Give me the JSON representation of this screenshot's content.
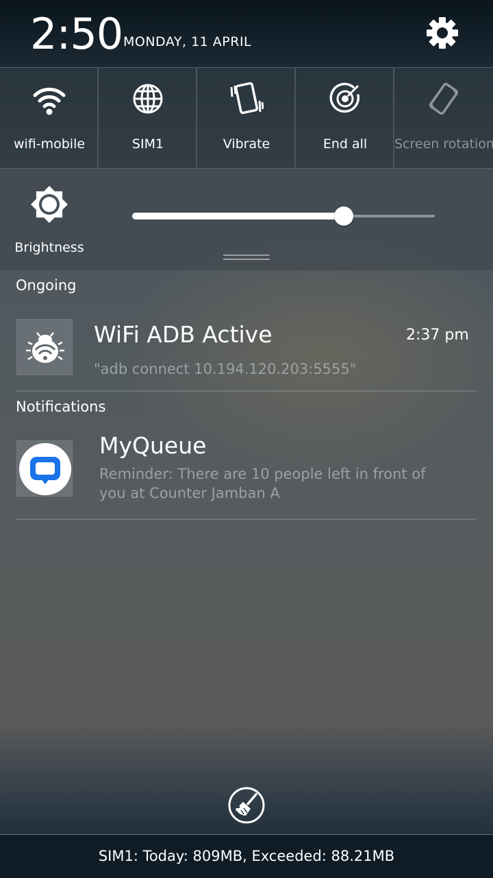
{
  "header": {
    "time": "2:50",
    "date": "MONDAY, 11 APRIL",
    "settings_icon": "gear-icon"
  },
  "quick_settings": [
    {
      "label": "wifi-mobile",
      "icon": "wifi-icon",
      "enabled": true
    },
    {
      "label": "SIM1",
      "icon": "globe-icon",
      "enabled": true
    },
    {
      "label": "Vibrate",
      "icon": "vibrate-icon",
      "enabled": true
    },
    {
      "label": "End all",
      "icon": "end-all-icon",
      "enabled": true
    },
    {
      "label": "Screen rotation",
      "icon": "screen-rotation-icon",
      "enabled": false
    }
  ],
  "brightness": {
    "label": "Brightness",
    "icon": "brightness-icon",
    "level": 0.7
  },
  "ongoing": {
    "section_title": "Ongoing",
    "items": [
      {
        "title": "WiFi ADB Active",
        "text": "\"adb connect 10.194.120.203:5555\"",
        "time": "2:37 pm",
        "icon": "bug-wifi-icon"
      }
    ]
  },
  "notifications": {
    "section_title": "Notifications",
    "items": [
      {
        "title": "MyQueue",
        "text": "Reminder: There are 10 people left in front of you at Counter Jamban A",
        "icon": "myqueue-app-icon"
      }
    ]
  },
  "footer": {
    "clear_icon": "broom-clear-icon",
    "data_usage": "SIM1: Today: 809MB, Exceeded: 88.21MB"
  },
  "colors": {
    "accent_blue": "#1a73e8",
    "header_bg": "#0a151d",
    "muted_text": "#9aa1a6"
  }
}
